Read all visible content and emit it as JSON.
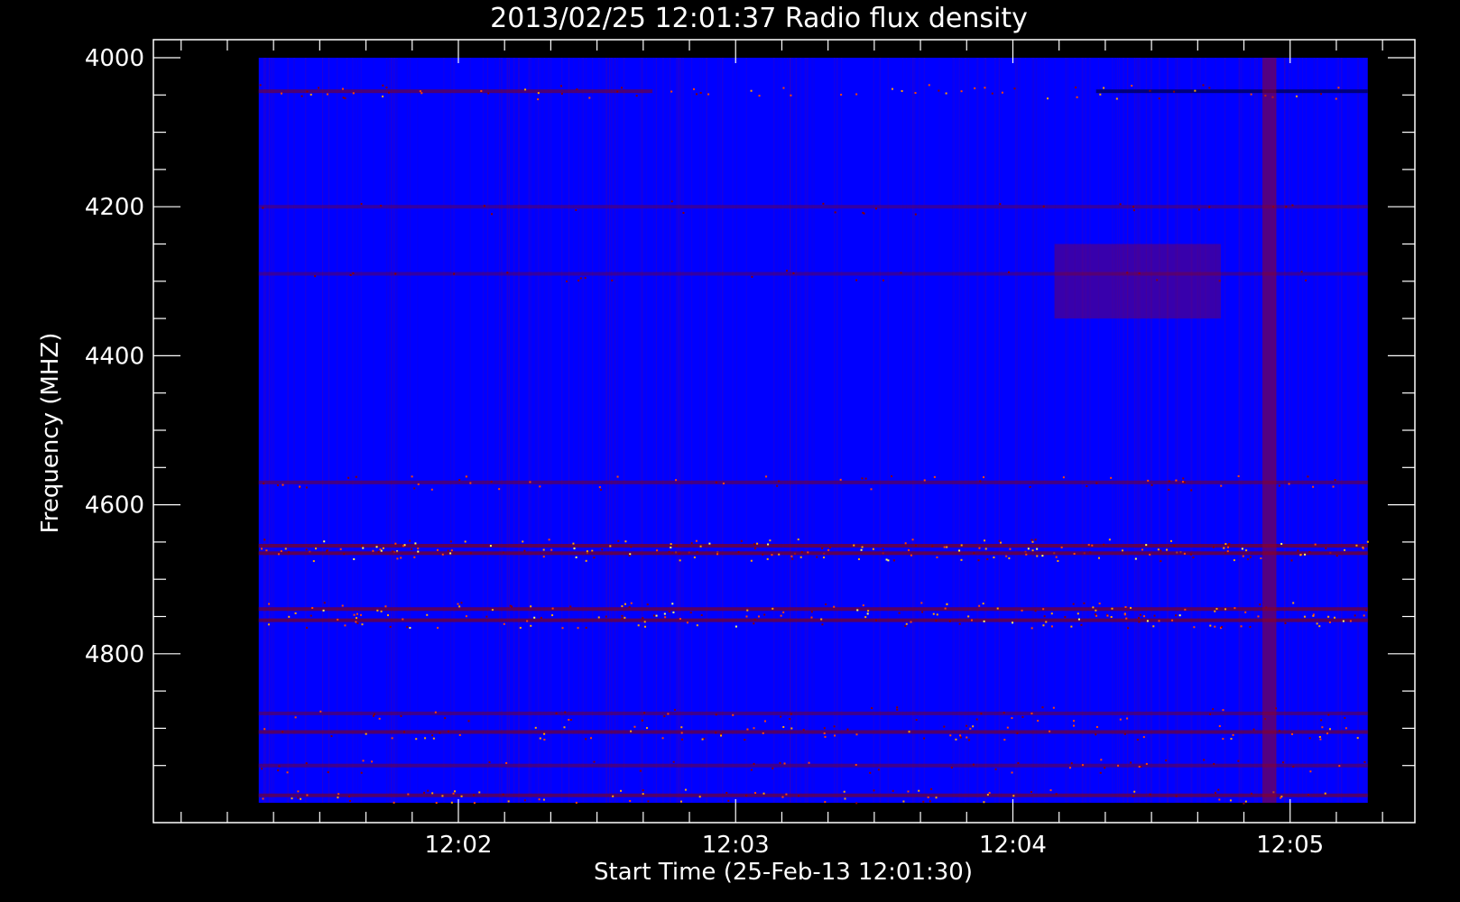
{
  "chart_data": {
    "type": "heatmap",
    "title": "2013/02/25 12:01:37 Radio flux density",
    "xlabel": "Start Time (25-Feb-13 12:01:30)",
    "ylabel": "Frequency (MHZ)",
    "x_ticks": [
      {
        "label": "12:02",
        "minutes": 0.5
      },
      {
        "label": "12:03",
        "minutes": 1.5
      },
      {
        "label": "12:04",
        "minutes": 2.5
      },
      {
        "label": "12:05",
        "minutes": 3.5
      }
    ],
    "xlim_minutes": [
      -0.6,
      3.95
    ],
    "data_x_minutes": [
      -0.22,
      3.78
    ],
    "y_ticks": [
      4000,
      4200,
      4400,
      4600,
      4800
    ],
    "ylim": [
      4000,
      5000
    ],
    "y_reversed": true,
    "colormap": [
      "#0000ff",
      "#8b0000",
      "#ff4500",
      "#ffa500",
      "#ffff66"
    ],
    "background_color": "#0000ff",
    "horizontal_bands_mhz": [
      {
        "freq": 4045,
        "intensity": 0.6,
        "extent_minutes": [
          -0.22,
          1.2
        ],
        "dark_after": 2.8
      },
      {
        "freq": 4200,
        "intensity": 0.2
      },
      {
        "freq": 4290,
        "intensity": 0.2
      },
      {
        "freq": 4570,
        "intensity": 0.5
      },
      {
        "freq": 4655,
        "intensity": 0.9
      },
      {
        "freq": 4665,
        "intensity": 0.9
      },
      {
        "freq": 4740,
        "intensity": 0.8
      },
      {
        "freq": 4755,
        "intensity": 0.8
      },
      {
        "freq": 4880,
        "intensity": 0.4
      },
      {
        "freq": 4905,
        "intensity": 0.7
      },
      {
        "freq": 4950,
        "intensity": 0.4
      },
      {
        "freq": 4990,
        "intensity": 0.7
      }
    ],
    "bursts": [
      {
        "minutes_from": 2.65,
        "minutes_to": 3.25,
        "freq_from": 4250,
        "freq_to": 4350,
        "intensity": 0.4
      },
      {
        "minutes_from": 3.4,
        "minutes_to": 3.45,
        "freq_from": 4000,
        "freq_to": 5000,
        "intensity": 0.8
      }
    ]
  }
}
